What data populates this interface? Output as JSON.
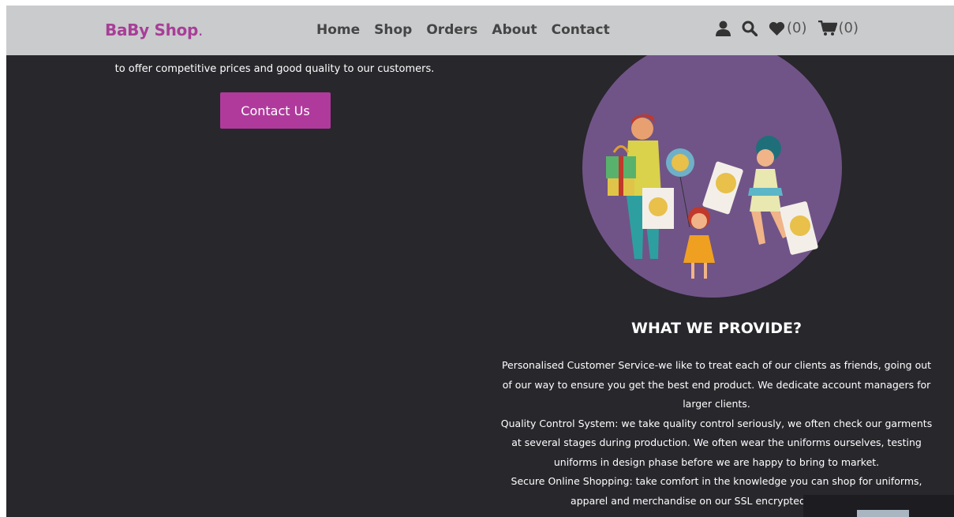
{
  "brand": {
    "name": "BaBy Shop",
    "dot": "."
  },
  "nav": {
    "links": [
      "Home",
      "Shop",
      "Orders",
      "About",
      "Contact"
    ],
    "wishlist_count": "(0)",
    "cart_count": "(0)"
  },
  "intro": {
    "text": "to offer competitive prices and good quality to our customers.",
    "button_label": "Contact Us"
  },
  "provide": {
    "title": "WHAT WE PROVIDE?",
    "paragraphs": [
      "Personalised Customer Service-we like to treat each of our clients as friends, going out of our way to ensure you get the best end product. We dedicate account managers for larger clients.",
      "Quality Control System: we take quality control seriously, we often check our garments at several stages during production. We often wear the uniforms ourselves, testing uniforms in design phase before we are happy to bring to market.",
      "Secure Online Shopping: take comfort in the knowledge you can shop for uniforms, apparel and merchandise on our SSL encrypted secure onli"
    ]
  },
  "colors": {
    "accent": "#b03a9c",
    "brand": "#a83e97",
    "background": "#28272c",
    "navbar": "#c9cbcd",
    "circle": "#705487"
  },
  "icons": {
    "user": "user-icon",
    "search": "search-icon",
    "heart": "heart-icon",
    "cart": "cart-icon"
  }
}
